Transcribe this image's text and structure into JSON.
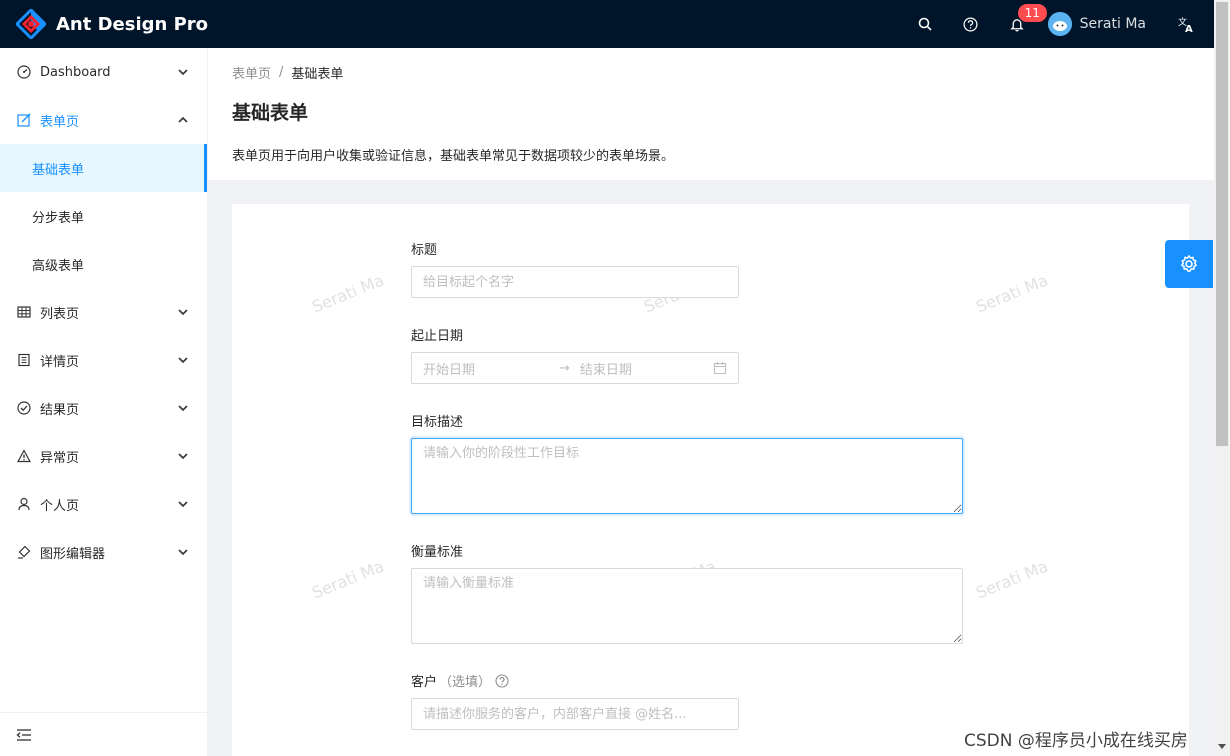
{
  "header": {
    "app_title": "Ant Design Pro",
    "notification_count": "11",
    "user_name": "Serati Ma",
    "icons": [
      "search-icon",
      "question-icon",
      "bell-icon",
      "translate-icon"
    ]
  },
  "sidebar": {
    "items": [
      {
        "label": "Dashboard",
        "icon": "dashboard-icon"
      },
      {
        "label": "表单页",
        "icon": "form-icon",
        "open": true
      },
      {
        "label": "列表页",
        "icon": "table-icon"
      },
      {
        "label": "详情页",
        "icon": "profile-icon"
      },
      {
        "label": "结果页",
        "icon": "check-circle-icon"
      },
      {
        "label": "异常页",
        "icon": "warning-icon"
      },
      {
        "label": "个人页",
        "icon": "user-icon"
      },
      {
        "label": "图形编辑器",
        "icon": "highlight-icon"
      }
    ],
    "sub_items": [
      {
        "label": "基础表单",
        "selected": true
      },
      {
        "label": "分步表单"
      },
      {
        "label": "高级表单"
      }
    ]
  },
  "page_header": {
    "breadcrumb": [
      "表单页",
      "/",
      "基础表单"
    ],
    "title": "基础表单",
    "description": "表单页用于向用户收集或验证信息，基础表单常见于数据项较少的表单场景。"
  },
  "form": {
    "title_label": "标题",
    "title_placeholder": "给目标起个名字",
    "date_label": "起止日期",
    "date_start_placeholder": "开始日期",
    "date_arrow": "→",
    "date_end_placeholder": "结束日期",
    "goal_label": "目标描述",
    "goal_placeholder": "请输入你的阶段性工作目标",
    "standard_label": "衡量标准",
    "standard_placeholder": "请输入衡量标准",
    "client_label": "客户",
    "client_optional": "（选填）",
    "client_placeholder": "请描述你服务的客户，内部客户直接 @姓名..."
  },
  "watermark_text": "Serati Ma",
  "footer_watermark": "CSDN @程序员小成在线买房",
  "colors": {
    "header_bg": "#001529",
    "primary": "#1890ff",
    "selected_bg": "#e6f7ff",
    "badge": "#ff4d4f"
  }
}
